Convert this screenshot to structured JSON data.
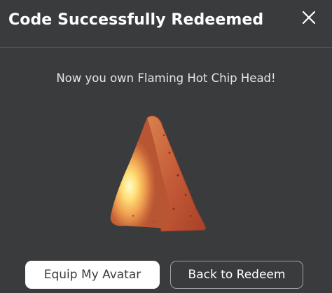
{
  "modal": {
    "title": "Code Successfully Redeemed",
    "message": "Now you own Flaming Hot Chip Head!",
    "item_image_icon": "flaming-hot-chip-head-item-image",
    "close_icon": "close-icon"
  },
  "buttons": {
    "equip_label": "Equip My Avatar",
    "back_label": "Back to Redeem"
  },
  "colors": {
    "background": "#393b3d",
    "primary_button_bg": "#ffffff",
    "secondary_button_border": "#a0a3a6",
    "divider": "#55585b"
  }
}
